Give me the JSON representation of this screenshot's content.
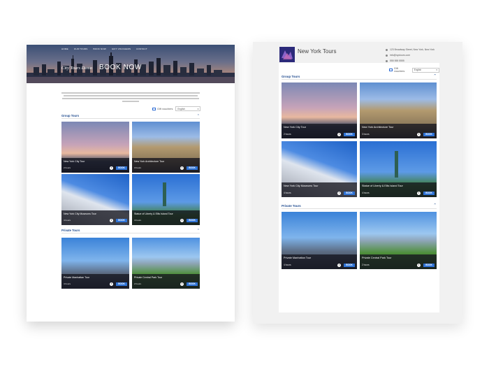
{
  "left_page": {
    "nav": [
      "HOME",
      "OUR TOURS",
      "BOOK NOW",
      "GIFT VOUCHERS",
      "CONTACT"
    ],
    "hero_subtitle": "City Tours Demo",
    "hero_title": "BOOK NOW",
    "gift_vouchers": "Gift vouchers",
    "language": "English",
    "sections": [
      {
        "title": "Group Tours",
        "tiles": [
          {
            "name": "New York City Tour",
            "duration": "2 hours",
            "book": "BOOK"
          },
          {
            "name": "New York Architecture Tour",
            "duration": "3 hours",
            "book": "BOOK"
          },
          {
            "name": "New York City Museums Tour",
            "duration": "4 hours",
            "book": "BOOK"
          },
          {
            "name": "Statue of Liberty & Ellis Island Tour",
            "duration": "4 hours",
            "book": "BOOK"
          }
        ]
      },
      {
        "title": "Private Tours",
        "tiles": [
          {
            "name": "Private Manhattan Tour",
            "duration": "4 hours",
            "book": "BOOK"
          },
          {
            "name": "Private Central Park Tour",
            "duration": "2 hours",
            "book": "BOOK"
          }
        ]
      }
    ]
  },
  "right_page": {
    "brand": "New York Tours",
    "contact": {
      "address": "123 Broadway Street, New York, New York",
      "email": "info@nyctours.com",
      "phone": "555 555 5555"
    },
    "gift_vouchers": "Gift vouchers",
    "language": "English",
    "sections": [
      {
        "title": "Group Tours",
        "tiles": [
          {
            "name": "New York City Tour",
            "duration": "2 hours",
            "book": "BOOK"
          },
          {
            "name": "New York Architecture Tour",
            "duration": "3 hours",
            "book": "BOOK"
          },
          {
            "name": "New York City Museums Tour",
            "duration": "4 hours",
            "book": "BOOK"
          },
          {
            "name": "Statue of Liberty & Ellis Island Tour",
            "duration": "4 hours",
            "book": "BOOK"
          }
        ]
      },
      {
        "title": "Private Tours",
        "tiles": [
          {
            "name": "Private Manhattan Tour",
            "duration": "4 hours",
            "book": "BOOK"
          },
          {
            "name": "Private Central Park Tour",
            "duration": "2 hours",
            "book": "BOOK"
          }
        ]
      }
    ]
  },
  "icons": {
    "info": "info-icon",
    "gift": "gift-icon",
    "chevron": "chevron-up-icon",
    "location": "location-pin-icon",
    "email": "email-icon",
    "phone": "phone-icon"
  },
  "colors": {
    "accent": "#2f73d6",
    "heading": "#214c8f"
  }
}
